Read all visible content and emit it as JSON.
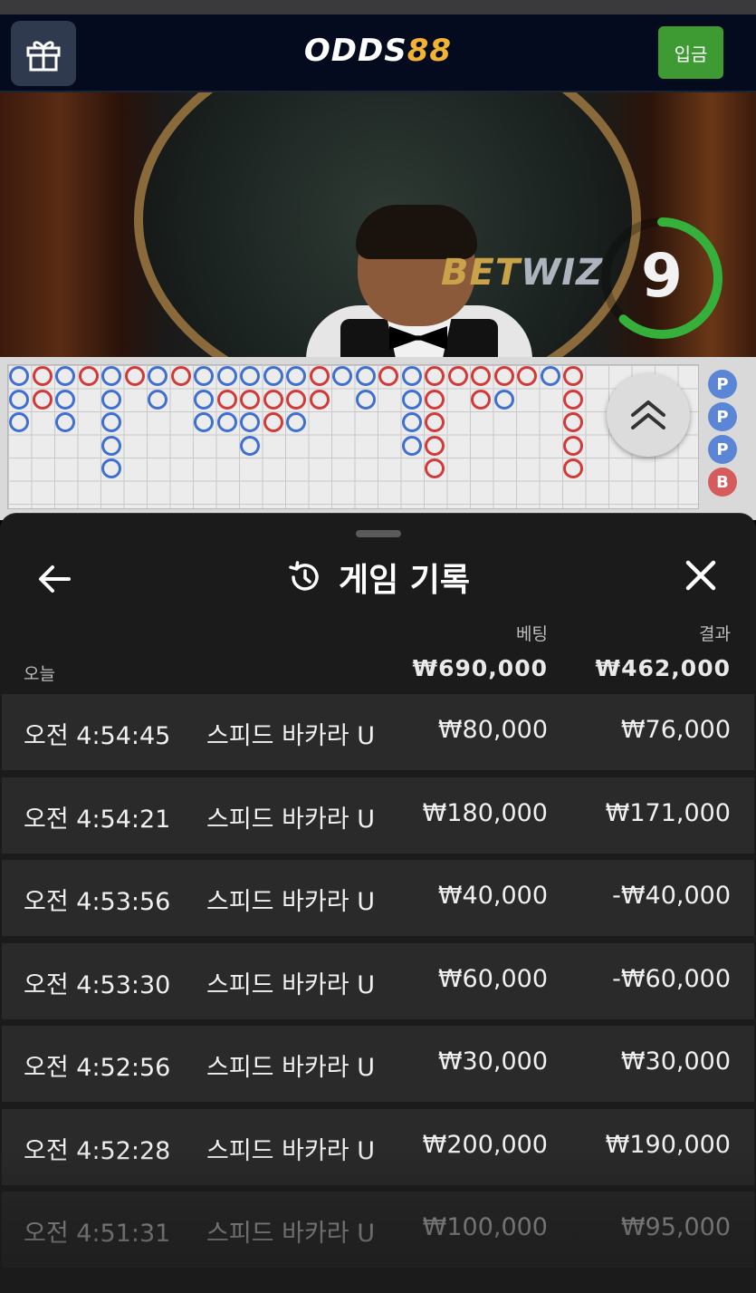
{
  "header": {
    "logo_part1": "ODDS",
    "logo_part2": "88",
    "deposit_label": "입금"
  },
  "video": {
    "brand_part1": "BET",
    "brand_part2": "WIZ",
    "countdown": "9",
    "countdown_fraction": 0.62
  },
  "sheet": {
    "title": "게임 기록",
    "columns": {
      "bet": "베팅",
      "result": "결과"
    },
    "today_label": "오늘",
    "today_bet_total": "₩690,000",
    "today_result_total": "₩462,000",
    "rows": [
      {
        "time": "오전 4:54:45",
        "game": "스피드 바카라 U",
        "bet": "₩80,000",
        "result": "₩76,000"
      },
      {
        "time": "오전 4:54:21",
        "game": "스피드 바카라 U",
        "bet": "₩180,000",
        "result": "₩171,000"
      },
      {
        "time": "오전 4:53:56",
        "game": "스피드 바카라 U",
        "bet": "₩40,000",
        "result": "-₩40,000"
      },
      {
        "time": "오전 4:53:30",
        "game": "스피드 바카라 U",
        "bet": "₩60,000",
        "result": "-₩60,000"
      },
      {
        "time": "오전 4:52:56",
        "game": "스피드 바카라 U",
        "bet": "₩30,000",
        "result": "₩30,000"
      },
      {
        "time": "오전 4:52:28",
        "game": "스피드 바카라 U",
        "bet": "₩200,000",
        "result": "₩190,000"
      },
      {
        "time": "오전 4:51:31",
        "game": "스피드 바카라 U",
        "bet": "₩100,000",
        "result": "₩95,000"
      }
    ]
  },
  "roadmap": {
    "side_chips": [
      "P",
      "P",
      "P",
      "B"
    ]
  },
  "colors": {
    "player_blue": "#3f6fd1",
    "banker_red": "#d23a3a",
    "tie_green": "#2e9a3e",
    "deposit_green": "#3e9b34",
    "logo_gold": "#f2b233"
  },
  "icons": {
    "gift": "gift-icon",
    "back": "arrow-left-icon",
    "history": "history-icon",
    "close": "close-icon",
    "expand": "chevron-double-up-icon"
  }
}
